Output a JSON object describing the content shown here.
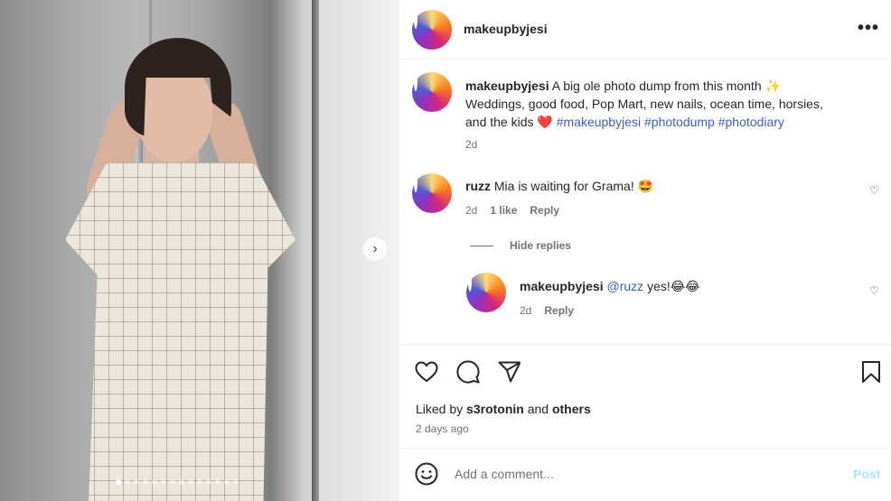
{
  "post": {
    "username": "makeupbyjesi",
    "more_icon": "more-horizontal-icon",
    "carousel": {
      "total_slides": 14,
      "current_slide": 1
    },
    "next_icon": "chevron-right-icon"
  },
  "caption": {
    "username": "makeupbyjesi",
    "text_line1": "A big ole photo dump from this month",
    "sparkle": "✨",
    "text_line2": "Weddings, good food, Pop Mart, new nails, ocean time, horsies,",
    "text_line3": "and the kids",
    "heart": "❤️",
    "hashtags": [
      "#makeupbyjesi",
      "#photodump",
      "#photodiary"
    ],
    "time": "2d"
  },
  "comments": [
    {
      "username": "ruzz",
      "text": "Mia is waiting for Grama!",
      "emoji": "🤩",
      "time": "2d",
      "likes": "1 like",
      "reply_label": "Reply"
    }
  ],
  "hide_replies_label": "Hide replies",
  "replies": [
    {
      "username": "makeupbyjesi",
      "mention": "@ruzz",
      "text": "yes!",
      "emoji": "😂😂",
      "time": "2d",
      "reply_label": "Reply"
    }
  ],
  "actions": {
    "liked_prefix": "Liked by",
    "liked_user": "s3rotonin",
    "liked_and": "and",
    "liked_others": "others",
    "posted_ago": "2 days ago"
  },
  "composer": {
    "placeholder": "Add a comment...",
    "post_label": "Post",
    "post_color": "#b2dffc"
  },
  "colors": {
    "link": "#3b5fc0",
    "muted": "#737373",
    "text": "#262626"
  }
}
